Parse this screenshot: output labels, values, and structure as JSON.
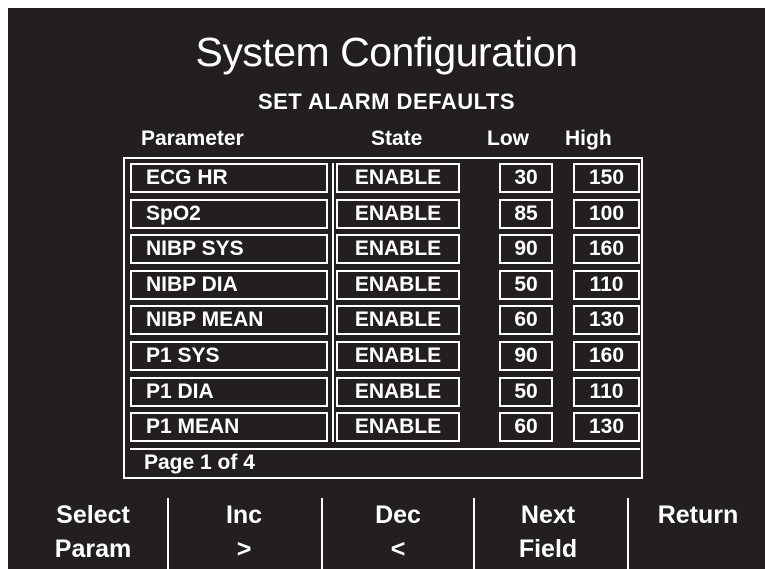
{
  "header": {
    "title": "System Configuration",
    "subtitle": "SET ALARM DEFAULTS"
  },
  "table": {
    "columns": [
      "Parameter",
      "State",
      "Low",
      "High"
    ],
    "rows": [
      {
        "param": "ECG HR",
        "state": "ENABLE",
        "low": "30",
        "high": "150"
      },
      {
        "param": "SpO2",
        "state": "ENABLE",
        "low": "85",
        "high": "100"
      },
      {
        "param": "NIBP SYS",
        "state": "ENABLE",
        "low": "90",
        "high": "160"
      },
      {
        "param": "NIBP DIA",
        "state": "ENABLE",
        "low": "50",
        "high": "110"
      },
      {
        "param": "NIBP MEAN",
        "state": "ENABLE",
        "low": "60",
        "high": "130"
      },
      {
        "param": "P1 SYS",
        "state": "ENABLE",
        "low": "90",
        "high": "160"
      },
      {
        "param": "P1 DIA",
        "state": "ENABLE",
        "low": "50",
        "high": "110"
      },
      {
        "param": "P1 MEAN",
        "state": "ENABLE",
        "low": "60",
        "high": "130"
      }
    ],
    "page_indicator": "Page 1 of 4"
  },
  "softkeys": [
    {
      "line1": "Select",
      "line2": "Param"
    },
    {
      "line1": "Inc",
      "line2": ">"
    },
    {
      "line1": "Dec",
      "line2": "<"
    },
    {
      "line1": "Next",
      "line2": "Field"
    },
    {
      "line1": "",
      "line2": "Return"
    }
  ],
  "colors": {
    "background": "#231f20",
    "foreground": "#ffffff"
  }
}
